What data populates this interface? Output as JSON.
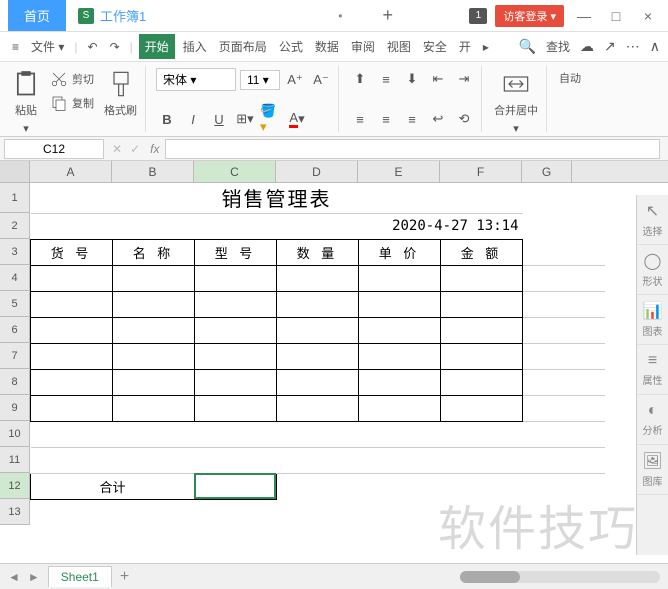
{
  "titlebar": {
    "home_tab": "首页",
    "workbook_tab": "工作簿1",
    "workbook_icon": "S",
    "badge": "1",
    "guest_login": "访客登录",
    "minimize": "—",
    "maximize": "□",
    "close": "×",
    "new_tab": "+"
  },
  "menubar": {
    "file": "文件",
    "tabs": [
      "开始",
      "插入",
      "页面布局",
      "公式",
      "数据",
      "审阅",
      "视图",
      "安全",
      "开"
    ],
    "search": "查找",
    "active_index": 0
  },
  "ribbon": {
    "paste": "粘贴",
    "cut": "剪切",
    "copy": "复制",
    "format_painter": "格式刷",
    "font_name": "宋体",
    "font_size": "11",
    "merge_center": "合并居中",
    "auto": "自动"
  },
  "namebox": "C12",
  "formula_bar": "",
  "columns": [
    "A",
    "B",
    "C",
    "D",
    "E",
    "F",
    "G"
  ],
  "rows": [
    "1",
    "2",
    "3",
    "4",
    "5",
    "6",
    "7",
    "8",
    "9",
    "10",
    "11",
    "12",
    "13"
  ],
  "selected_cell": "C12",
  "sheet": {
    "title": "销售管理表",
    "date": "2020-4-27 13:14",
    "headers": [
      "货 号",
      "名 称",
      "型 号",
      "数 量",
      "单 价",
      "金 额"
    ],
    "total_label": "合计"
  },
  "chart_data": {
    "type": "table",
    "title": "销售管理表",
    "date": "2020-4-27 13:14",
    "columns": [
      "货号",
      "名称",
      "型号",
      "数量",
      "单价",
      "金额"
    ],
    "rows": [
      [
        "",
        "",
        "",
        "",
        "",
        ""
      ],
      [
        "",
        "",
        "",
        "",
        "",
        ""
      ],
      [
        "",
        "",
        "",
        "",
        "",
        ""
      ],
      [
        "",
        "",
        "",
        "",
        "",
        ""
      ],
      [
        "",
        "",
        "",
        "",
        "",
        ""
      ],
      [
        "",
        "",
        "",
        "",
        "",
        ""
      ]
    ],
    "total_row": [
      "合计",
      "",
      "",
      "",
      "",
      ""
    ]
  },
  "sidepanel": [
    "选择",
    "形状",
    "图表",
    "属性",
    "分析",
    "图库"
  ],
  "sheetbar": {
    "sheet_name": "Sheet1",
    "add": "+"
  },
  "watermark": "软件技巧"
}
